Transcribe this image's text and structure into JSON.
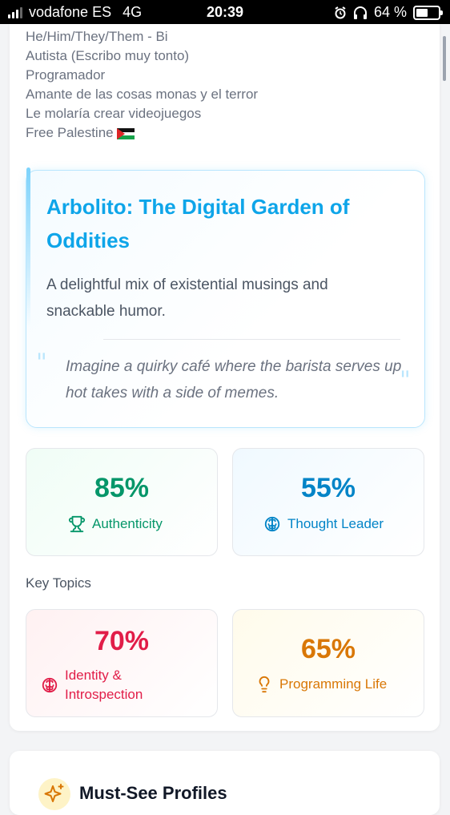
{
  "status_bar": {
    "carrier": "vodafone ES",
    "network": "4G",
    "time": "20:39",
    "battery": "64 %",
    "battery_fraction": 0.64
  },
  "bio": {
    "lines": [
      "He/Him/They/Them - Bi",
      "Autista (Escribo muy tonto)",
      "Programador",
      "Amante de las cosas monas y el terror",
      "Le molaría crear videojuegos",
      "Free Palestine"
    ]
  },
  "highlight": {
    "title": "Arbolito: The Digital Garden of Oddities",
    "subtitle": "A delightful mix of existential musings and snackable humor.",
    "quote": "Imagine a quirky café where the barista serves up hot takes with a side of memes."
  },
  "stats": [
    {
      "value": "85%",
      "label": "Authenticity",
      "icon": "trophy-icon",
      "color": "#059669"
    },
    {
      "value": "55%",
      "label": "Thought Leader",
      "icon": "brain-icon",
      "color": "#0284c7"
    }
  ],
  "key_topics": {
    "heading": "Key Topics",
    "items": [
      {
        "value": "70%",
        "label": "Identity & Introspection",
        "icon": "brain-icon",
        "color": "#e11d48"
      },
      {
        "value": "65%",
        "label": "Programming Life",
        "icon": "lightbulb-icon",
        "color": "#d97706"
      }
    ]
  },
  "next_section": {
    "title": "Must-See Profiles",
    "icon": "sparkles-icon"
  }
}
